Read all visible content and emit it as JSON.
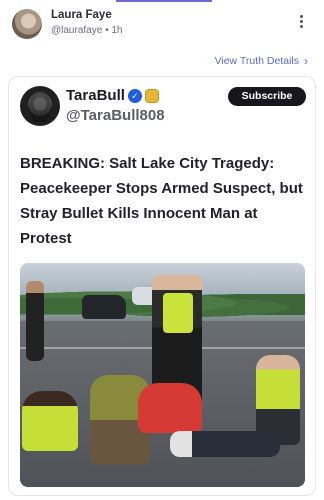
{
  "post": {
    "author_name": "Laura Faye",
    "author_handle": "@laurafaye",
    "separator": "•",
    "time": "1h",
    "more_icon": "kebab-menu-icon",
    "details_link": "View Truth Details",
    "details_icon": "chevron-right-icon"
  },
  "card": {
    "account_name": "TaraBull",
    "verified_icon": "verified-check-icon",
    "badge_icon": "gold-badge-icon",
    "account_handle": "@TaraBull808",
    "subscribe_label": "Subscribe",
    "headline": "BREAKING: Salt Lake City Tragedy: Peacekeeper Stops Armed Suspect, but Stray Bullet Kills Innocent Man at Protest"
  },
  "colors": {
    "accent": "#6b6bd6",
    "link": "#5a6bd8",
    "subscribe_bg": "#16161c",
    "verified": "#1d5fd6"
  }
}
